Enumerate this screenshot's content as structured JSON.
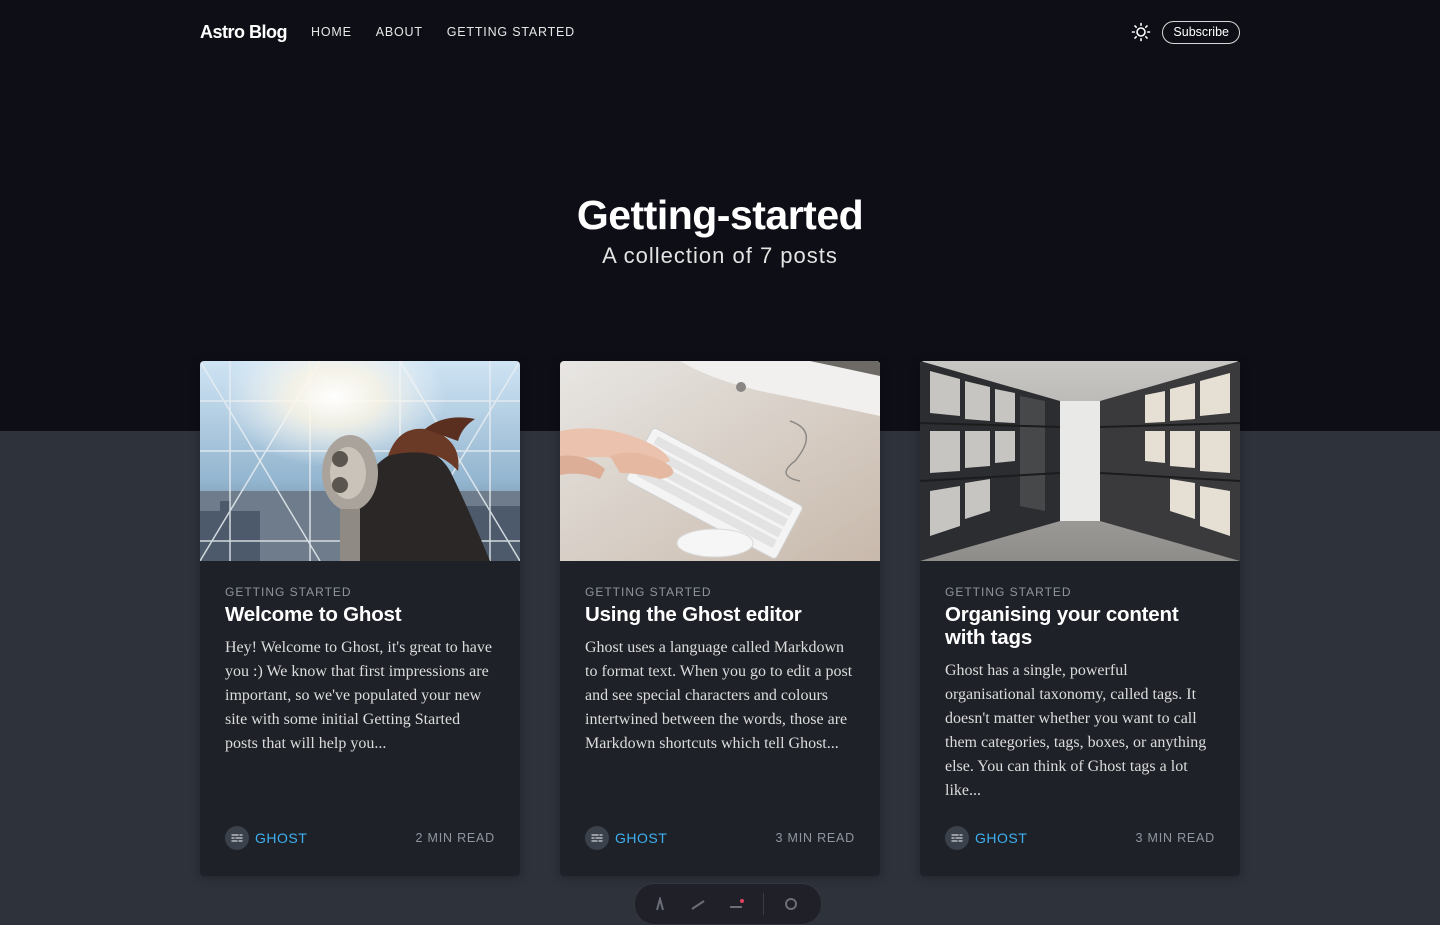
{
  "header": {
    "brand": "Astro Blog",
    "nav": [
      "HOME",
      "ABOUT",
      "GETTING STARTED"
    ],
    "subscribe_label": "Subscribe",
    "theme_icon": "sun-icon"
  },
  "hero": {
    "title": "Getting-started",
    "subtitle": "A collection of 7 posts"
  },
  "posts": [
    {
      "tag": "GETTING STARTED",
      "title": "Welcome to Ghost",
      "excerpt": "Hey! Welcome to Ghost, it's great to have you :) We know that first impressions are important, so we've populated your new site with some initial Getting Started posts that will help you...",
      "author": "GHOST",
      "read_time": "2 MIN READ",
      "image": "person-using-binoculars-photo"
    },
    {
      "tag": "GETTING STARTED",
      "title": "Using the Ghost editor",
      "excerpt": "Ghost uses a language called Markdown to format text. When you go to edit a post and see special characters and colours intertwined between the words, those are Markdown shortcuts which tell Ghost...",
      "author": "GHOST",
      "read_time": "3 MIN READ",
      "image": "hands-on-keyboard-photo"
    },
    {
      "tag": "GETTING STARTED",
      "title": "Organising your content with tags",
      "excerpt": "Ghost has a single, powerful organisational taxonomy, called tags. It doesn't matter whether you want to call them categories, tags, boxes, or anything else. You can think of Ghost tags a lot like...",
      "author": "GHOST",
      "read_time": "3 MIN READ",
      "image": "archive-shelves-photo"
    }
  ],
  "colors": {
    "hero_bg": "#0e0f16",
    "page_bg": "#2e323b",
    "card_bg": "#1f2128",
    "accent": "#3eb0ef"
  }
}
